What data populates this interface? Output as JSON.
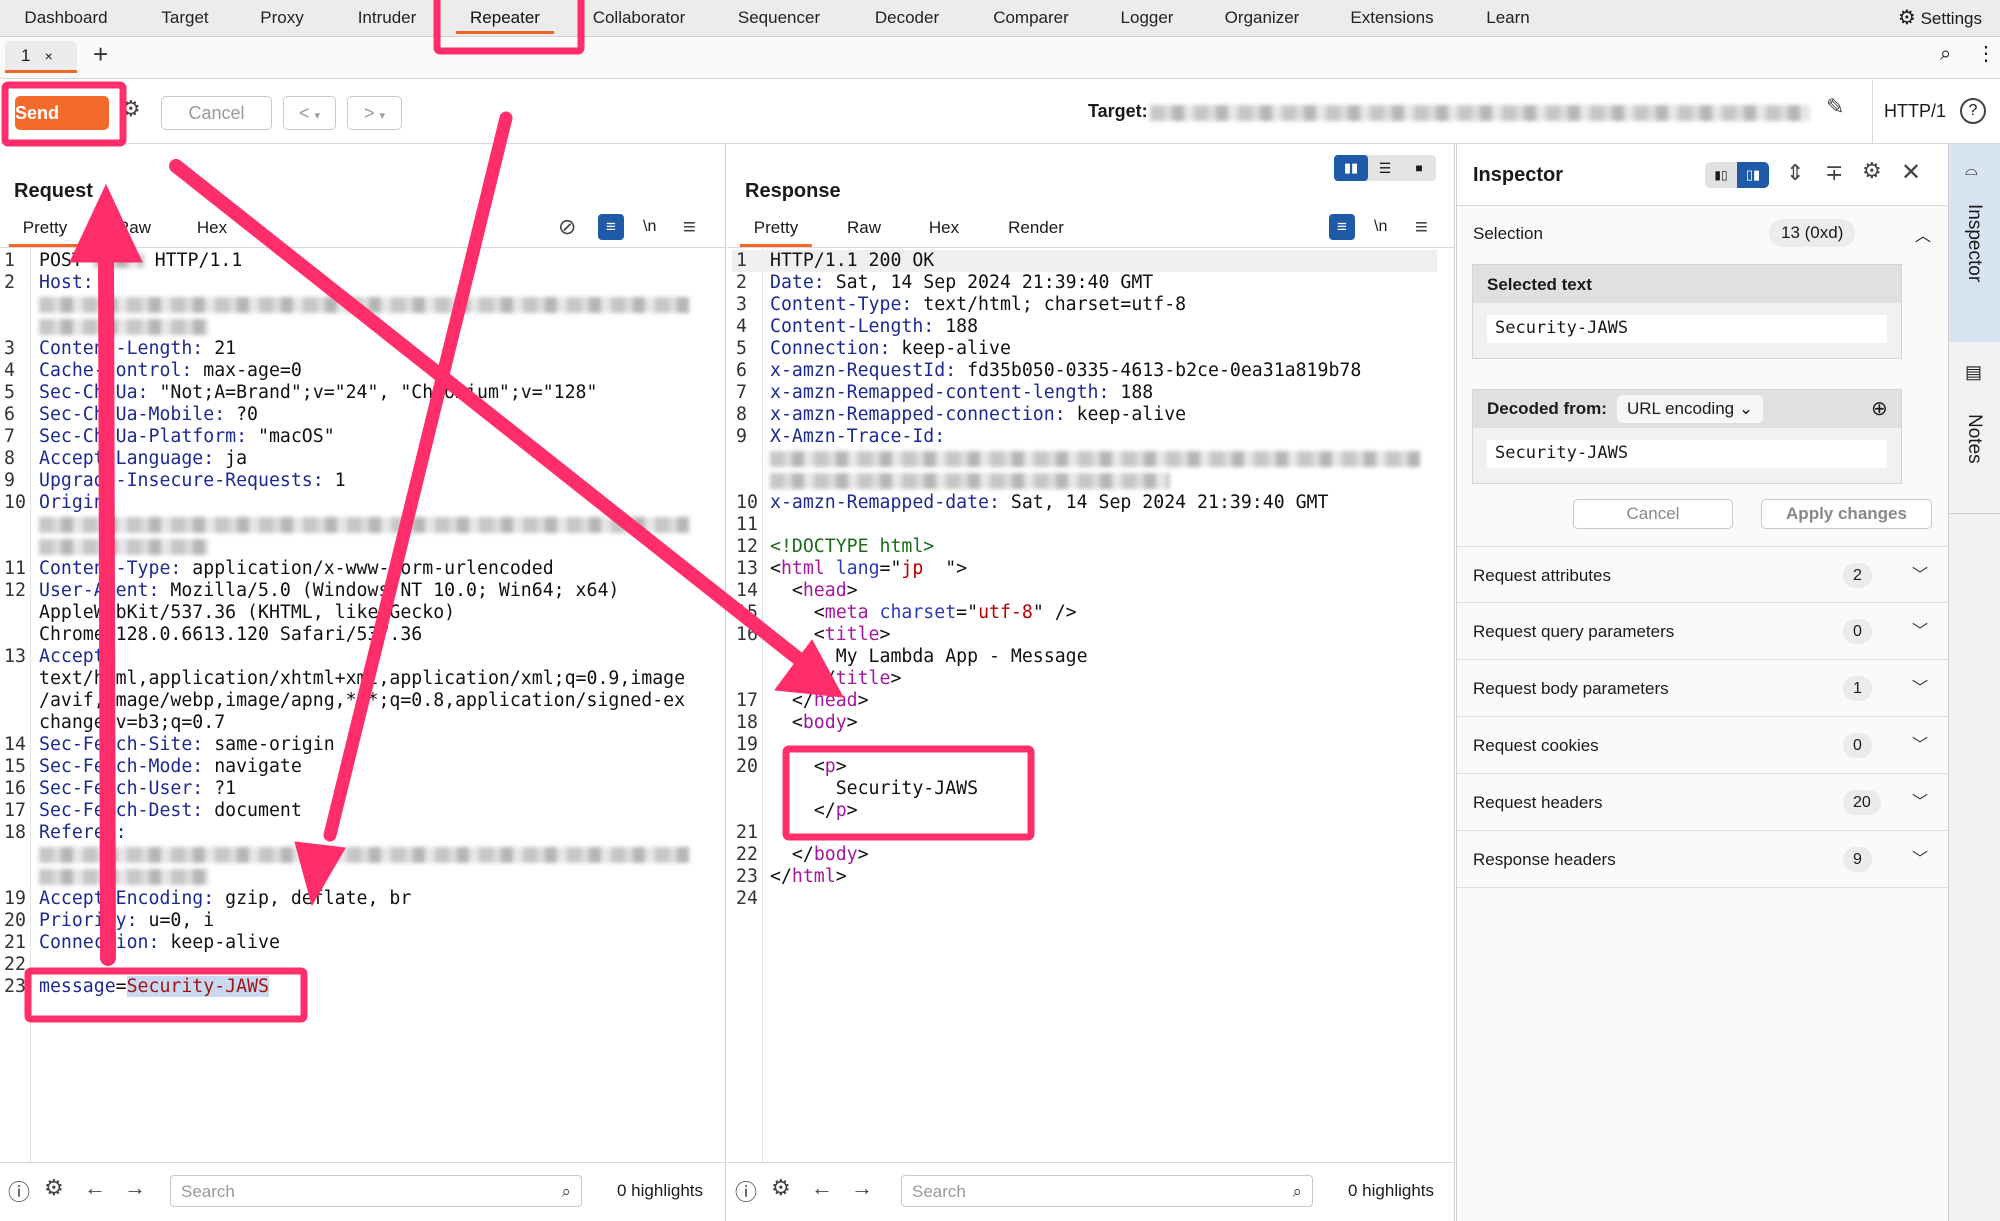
{
  "nav": {
    "items": [
      "Dashboard",
      "Target",
      "Proxy",
      "Intruder",
      "Repeater",
      "Collaborator",
      "Sequencer",
      "Decoder",
      "Comparer",
      "Logger",
      "Organizer",
      "Extensions",
      "Learn"
    ],
    "active": "Repeater",
    "settings": "Settings"
  },
  "repeater_tabs": {
    "tab": "1",
    "close": "×",
    "add": "+"
  },
  "toolbar": {
    "send": "Send",
    "cancel": "Cancel",
    "prev": "<",
    "next": ">",
    "target_label": "Target:",
    "protocol": "HTTP/1"
  },
  "request": {
    "title": "Request",
    "tabs": [
      "Pretty",
      "Raw",
      "Hex"
    ],
    "active_tab": "Pretty",
    "rows": [
      {
        "n": "1",
        "parts": [
          [
            "v",
            "POST "
          ],
          [
            "blur",
            "inl"
          ],
          [
            "v",
            " HTTP/1.1"
          ]
        ]
      },
      {
        "n": "2",
        "parts": [
          [
            "k",
            "Host:"
          ]
        ]
      },
      {
        "n": "",
        "parts": [
          [
            "blur",
            "long"
          ]
        ]
      },
      {
        "n": "",
        "parts": [
          [
            "blur",
            "short"
          ]
        ]
      },
      {
        "n": "3",
        "parts": [
          [
            "k",
            "Content-Length:"
          ],
          [
            "v",
            " 21"
          ]
        ]
      },
      {
        "n": "4",
        "parts": [
          [
            "k",
            "Cache-Control:"
          ],
          [
            "v",
            " max-age=0"
          ]
        ]
      },
      {
        "n": "5",
        "parts": [
          [
            "k",
            "Sec-Ch-Ua:"
          ],
          [
            "v",
            " \"Not;A=Brand\";v=\"24\", \"Chromium\";v=\"128\""
          ]
        ]
      },
      {
        "n": "6",
        "parts": [
          [
            "k",
            "Sec-Ch-Ua-Mobile:"
          ],
          [
            "v",
            " ?0"
          ]
        ]
      },
      {
        "n": "7",
        "parts": [
          [
            "k",
            "Sec-Ch-Ua-Platform:"
          ],
          [
            "v",
            " \"macOS\""
          ]
        ]
      },
      {
        "n": "8",
        "parts": [
          [
            "k",
            "Accept-Language:"
          ],
          [
            "v",
            " ja"
          ]
        ]
      },
      {
        "n": "9",
        "parts": [
          [
            "k",
            "Upgrade-Insecure-Requests:"
          ],
          [
            "v",
            " 1"
          ]
        ]
      },
      {
        "n": "10",
        "parts": [
          [
            "k",
            "Origin:"
          ]
        ]
      },
      {
        "n": "",
        "parts": [
          [
            "blur",
            "long"
          ]
        ]
      },
      {
        "n": "",
        "parts": [
          [
            "blur",
            "short"
          ]
        ]
      },
      {
        "n": "11",
        "parts": [
          [
            "k",
            "Content-Type:"
          ],
          [
            "v",
            " application/x-www-form-urlencoded"
          ]
        ]
      },
      {
        "n": "12",
        "parts": [
          [
            "k",
            "User-Agent:"
          ],
          [
            "v",
            " Mozilla/5.0 (Windows NT 10.0; Win64; x64)"
          ]
        ]
      },
      {
        "n": "",
        "parts": [
          [
            "v",
            "AppleWebKit/537.36 (KHTML, like Gecko)"
          ]
        ]
      },
      {
        "n": "",
        "parts": [
          [
            "v",
            "Chrome/128.0.6613.120 Safari/537.36"
          ]
        ]
      },
      {
        "n": "13",
        "parts": [
          [
            "k",
            "Accept:"
          ]
        ]
      },
      {
        "n": "",
        "parts": [
          [
            "v",
            "text/html,application/xhtml+xml,application/xml;q=0.9,image"
          ]
        ]
      },
      {
        "n": "",
        "parts": [
          [
            "v",
            "/avif,image/webp,image/apng,*/*;q=0.8,application/signed-ex"
          ]
        ]
      },
      {
        "n": "",
        "parts": [
          [
            "v",
            "change;v=b3;q=0.7"
          ]
        ]
      },
      {
        "n": "14",
        "parts": [
          [
            "k",
            "Sec-Fetch-Site:"
          ],
          [
            "v",
            " same-origin"
          ]
        ]
      },
      {
        "n": "15",
        "parts": [
          [
            "k",
            "Sec-Fetch-Mode:"
          ],
          [
            "v",
            " navigate"
          ]
        ]
      },
      {
        "n": "16",
        "parts": [
          [
            "k",
            "Sec-Fetch-User:"
          ],
          [
            "v",
            " ?1"
          ]
        ]
      },
      {
        "n": "17",
        "parts": [
          [
            "k",
            "Sec-Fetch-Dest:"
          ],
          [
            "v",
            " document"
          ]
        ]
      },
      {
        "n": "18",
        "parts": [
          [
            "k",
            "Referer:"
          ]
        ]
      },
      {
        "n": "",
        "parts": [
          [
            "blur",
            "long"
          ]
        ]
      },
      {
        "n": "",
        "parts": [
          [
            "blur",
            "short"
          ]
        ]
      },
      {
        "n": "19",
        "parts": [
          [
            "k",
            "Accept-Encoding:"
          ],
          [
            "v",
            " gzip, deflate, br"
          ]
        ]
      },
      {
        "n": "20",
        "parts": [
          [
            "k",
            "Priority:"
          ],
          [
            "v",
            " u=0, i"
          ]
        ]
      },
      {
        "n": "21",
        "parts": [
          [
            "k",
            "Connection:"
          ],
          [
            "v",
            " keep-alive"
          ]
        ]
      },
      {
        "n": "22",
        "parts": []
      },
      {
        "n": "23",
        "parts": [
          [
            "k",
            "message"
          ],
          [
            "v",
            "="
          ],
          [
            "pv",
            "Security-JAWS"
          ]
        ]
      }
    ],
    "search_placeholder": "Search",
    "highlights": "0 highlights"
  },
  "response": {
    "title": "Response",
    "tabs": [
      "Pretty",
      "Raw",
      "Hex",
      "Render"
    ],
    "active_tab": "Pretty",
    "rows": [
      {
        "n": "1",
        "parts": [
          [
            "v",
            "HTTP/1.1 200 OK"
          ]
        ]
      },
      {
        "n": "2",
        "parts": [
          [
            "k",
            "Date:"
          ],
          [
            "v",
            " Sat, 14 Sep 2024 21:39:40 GMT"
          ]
        ]
      },
      {
        "n": "3",
        "parts": [
          [
            "k",
            "Content-Type:"
          ],
          [
            "v",
            " text/html; charset=utf-8"
          ]
        ]
      },
      {
        "n": "4",
        "parts": [
          [
            "k",
            "Content-Length:"
          ],
          [
            "v",
            " 188"
          ]
        ]
      },
      {
        "n": "5",
        "parts": [
          [
            "k",
            "Connection:"
          ],
          [
            "v",
            " keep-alive"
          ]
        ]
      },
      {
        "n": "6",
        "parts": [
          [
            "k",
            "x-amzn-RequestId:"
          ],
          [
            "v",
            " fd35b050-0335-4613-b2ce-0ea31a819b78"
          ]
        ]
      },
      {
        "n": "7",
        "parts": [
          [
            "k",
            "x-amzn-Remapped-content-length:"
          ],
          [
            "v",
            " 188"
          ]
        ]
      },
      {
        "n": "8",
        "parts": [
          [
            "k",
            "x-amzn-Remapped-connection:"
          ],
          [
            "v",
            " keep-alive"
          ]
        ]
      },
      {
        "n": "9",
        "parts": [
          [
            "k",
            "X-Amzn-Trace-Id:"
          ]
        ]
      },
      {
        "n": "",
        "parts": [
          [
            "blur",
            "long"
          ]
        ]
      },
      {
        "n": "",
        "parts": [
          [
            "blur",
            "mid"
          ]
        ]
      },
      {
        "n": "10",
        "parts": [
          [
            "k",
            "x-amzn-Remapped-date:"
          ],
          [
            "v",
            " Sat, 14 Sep 2024 21:39:40 GMT"
          ]
        ]
      },
      {
        "n": "11",
        "parts": []
      },
      {
        "n": "12",
        "parts": [
          [
            "dt",
            "<!DOCTYPE html>"
          ]
        ]
      },
      {
        "n": "13",
        "parts": [
          [
            "v",
            "<"
          ],
          [
            "tg",
            "html"
          ],
          [
            "at",
            " lang"
          ],
          [
            "v",
            "=\""
          ],
          [
            "av",
            "jp"
          ],
          [
            "v",
            "  \">"
          ]
        ]
      },
      {
        "n": "14",
        "parts": [
          [
            "v",
            "  <"
          ],
          [
            "tg",
            "head"
          ],
          [
            "v",
            ">"
          ]
        ]
      },
      {
        "n": "15",
        "parts": [
          [
            "v",
            "    <"
          ],
          [
            "tg",
            "meta"
          ],
          [
            "at",
            " charset"
          ],
          [
            "v",
            "=\""
          ],
          [
            "av",
            "utf-8"
          ],
          [
            "v",
            "\" />"
          ]
        ]
      },
      {
        "n": "16",
        "parts": [
          [
            "v",
            "    <"
          ],
          [
            "tg",
            "title"
          ],
          [
            "v",
            ">"
          ]
        ]
      },
      {
        "n": "",
        "parts": [
          [
            "v",
            "      My Lambda App - Message"
          ]
        ]
      },
      {
        "n": "",
        "parts": [
          [
            "v",
            "    </"
          ],
          [
            "tg",
            "title"
          ],
          [
            "v",
            ">"
          ]
        ]
      },
      {
        "n": "17",
        "parts": [
          [
            "v",
            "  </"
          ],
          [
            "tg",
            "head"
          ],
          [
            "v",
            ">"
          ]
        ]
      },
      {
        "n": "18",
        "parts": [
          [
            "v",
            "  <"
          ],
          [
            "tg",
            "body"
          ],
          [
            "v",
            ">"
          ]
        ]
      },
      {
        "n": "19",
        "parts": []
      },
      {
        "n": "20",
        "parts": [
          [
            "v",
            "    <"
          ],
          [
            "tg",
            "p"
          ],
          [
            "v",
            ">"
          ]
        ]
      },
      {
        "n": "",
        "parts": [
          [
            "v",
            "      Security-JAWS"
          ]
        ]
      },
      {
        "n": "",
        "parts": [
          [
            "v",
            "    </"
          ],
          [
            "tg",
            "p"
          ],
          [
            "v",
            ">"
          ]
        ]
      },
      {
        "n": "21",
        "parts": []
      },
      {
        "n": "22",
        "parts": [
          [
            "v",
            "  </"
          ],
          [
            "tg",
            "body"
          ],
          [
            "v",
            ">"
          ]
        ]
      },
      {
        "n": "23",
        "parts": [
          [
            "v",
            "</"
          ],
          [
            "tg",
            "html"
          ],
          [
            "v",
            ">"
          ]
        ]
      },
      {
        "n": "24",
        "parts": []
      }
    ],
    "search_placeholder": "Search",
    "highlights": "0 highlights"
  },
  "inspector": {
    "title": "Inspector",
    "selection_label": "Selection",
    "selection_value": "13 (0xd)",
    "selected_text_label": "Selected text",
    "selected_text": "Security-JAWS",
    "decoded_from_label": "Decoded from:",
    "decoding": "URL encoding",
    "decoded_text": "Security-JAWS",
    "cancel": "Cancel",
    "apply": "Apply changes",
    "sections": [
      {
        "label": "Request attributes",
        "count": "2"
      },
      {
        "label": "Request query parameters",
        "count": "0"
      },
      {
        "label": "Request body parameters",
        "count": "1"
      },
      {
        "label": "Request cookies",
        "count": "0"
      },
      {
        "label": "Request headers",
        "count": "20"
      },
      {
        "label": "Response headers",
        "count": "9"
      }
    ]
  },
  "sidebar": {
    "inspector": "Inspector",
    "notes": "Notes"
  },
  "colors": {
    "accent": "#f26522",
    "send": "#f26b2d",
    "annotation": "#ff2d6a",
    "active_icon": "#1e5aa8"
  }
}
